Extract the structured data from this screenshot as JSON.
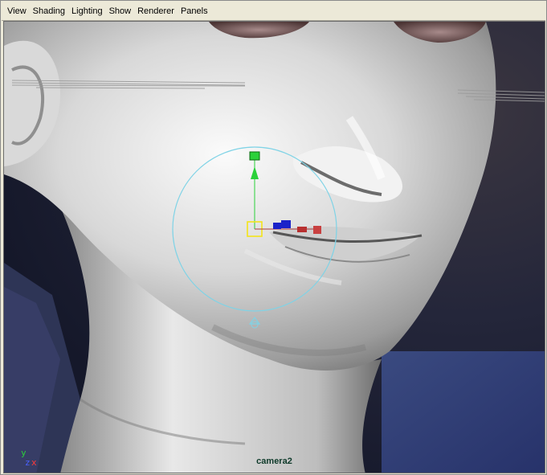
{
  "menu": {
    "items": [
      "View",
      "Shading",
      "Lighting",
      "Show",
      "Renderer",
      "Panels"
    ]
  },
  "viewport": {
    "camera_label": "camera2",
    "axis": {
      "y": "y",
      "z": "z",
      "x": "x"
    }
  },
  "colors": {
    "menubar_bg": "#ece9d8",
    "manipulator_ring": "#7fd3e6",
    "axis_x": "#ff3a3a",
    "axis_y": "#2bd13a",
    "axis_z": "#4a61ff"
  },
  "icons": [
    "move-manipulator-icon",
    "pivot-icon",
    "view-axis-gizmo-icon"
  ]
}
